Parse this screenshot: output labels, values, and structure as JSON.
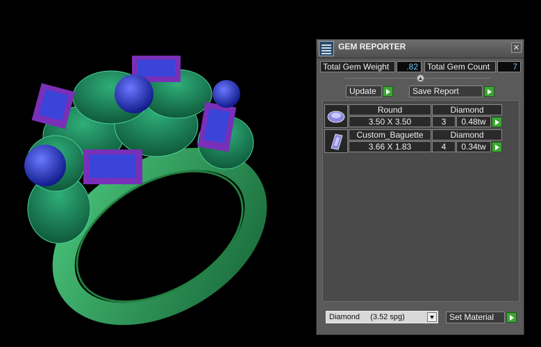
{
  "panel": {
    "title": "GEM REPORTER",
    "close_glyph": "✕",
    "total_weight_label": "Total Gem Weight",
    "total_weight_value": ".82",
    "total_count_label": "Total Gem Count",
    "total_count_value": "7",
    "update_label": "Update",
    "save_report_label": "Save Report"
  },
  "gems": [
    {
      "shape": "Round",
      "material": "Diamond",
      "size": "3.50 X 3.50",
      "count": "3",
      "weight": "0.48tw",
      "icon": "round-gem-icon"
    },
    {
      "shape": "Custom_Baguette",
      "material": "Diamond",
      "size": "3.66 X 1.83",
      "count": "4",
      "weight": "0.34tw",
      "icon": "baguette-gem-icon"
    }
  ],
  "footer": {
    "material_select": "Diamond     (3.52 spg)",
    "set_material_label": "Set Material"
  },
  "colors": {
    "ring_green": "#2f9a62",
    "gem_blue": "#2a3fd0",
    "setting_purple": "#7a2fb8",
    "accent_green": "#3fa534",
    "value_blue": "#6fc6ff"
  }
}
